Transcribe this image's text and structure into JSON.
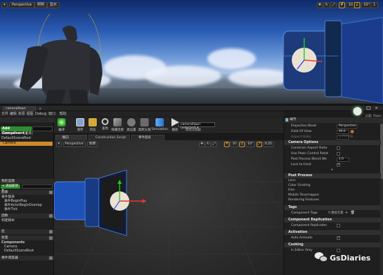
{
  "viewport": {
    "perspective_label": "Perspective",
    "lit_label": "照明",
    "show_label": "显示",
    "snap_value": "10",
    "angle_value": "10°",
    "scale_value": "0.25",
    "layer_value": "1"
  },
  "window": {
    "tab_title": "cameraPawn",
    "top_right_label": "父类: Pawn"
  },
  "menubar": {
    "items": [
      "文件",
      "编辑",
      "资源",
      "视图",
      "Debug",
      "窗口",
      "帮助"
    ]
  },
  "toolbar": {
    "buttons": [
      {
        "label": "编译",
        "icon": "compile-icon"
      },
      {
        "label": "保存",
        "icon": "save-icon"
      },
      {
        "label": "浏览",
        "icon": "browse-icon"
      },
      {
        "label": "查找",
        "icon": "find-icon"
      },
      {
        "label": "隐藏连接",
        "icon": "hide-connections-icon"
      },
      {
        "label": "类设置",
        "icon": "class-settings-icon"
      },
      {
        "label": "类默认值",
        "icon": "class-defaults-icon"
      },
      {
        "label": "Simulation",
        "icon": "simulation-icon"
      },
      {
        "label": "播放",
        "icon": "play-icon"
      }
    ],
    "debug_select_value": "cameraPawn (selected) ▾",
    "debug_filter_label": "调试过滤器"
  },
  "components": {
    "add_component_label": "Add Component ▾",
    "self_label": "cameraPawn (自身)",
    "tree": [
      {
        "label": "DefaultSceneRoot",
        "selected": false
      },
      {
        "label": "Camera",
        "selected": true
      }
    ]
  },
  "my_blueprint": {
    "header": "我的蓝图",
    "add_new_label": "+ 添加新项 ▾",
    "graphs_label": "图表",
    "event_graph_label": "事件图表",
    "events": [
      "事件BeginPlay",
      "事件ActorBeginOverlap",
      "事件Tick"
    ],
    "functions_label": "函数",
    "construction_label": "构建脚本",
    "macros_label": "宏",
    "variables_label": "变量",
    "components_group_label": "Components",
    "component_vars": [
      "Camera",
      "DefaultSceneRoot"
    ],
    "dispatchers_label": "事件调度器"
  },
  "tabs": [
    {
      "label": "视口",
      "active": true
    },
    {
      "label": "Construction Script",
      "active": false
    },
    {
      "label": "事件图表",
      "active": false
    }
  ],
  "bp_viewport": {
    "perspective_label": "Perspective",
    "lit_label": "照明",
    "snap_value": "10",
    "angle_value": "10°",
    "scale_value": "0.25"
  },
  "details": {
    "header": "细节",
    "projection_mode": {
      "key": "Projection Mode",
      "value": "Perspective"
    },
    "field_of_view": {
      "key": "Field Of View",
      "value": "90.0"
    },
    "aspect_ratio": {
      "key": "Aspect Ratio",
      "value": "1.777778"
    },
    "camera_options": {
      "title": "Camera Options",
      "rows": [
        {
          "key": "Constrain Aspect Ratio",
          "checked": false
        },
        {
          "key": "Use Pawn Control Rotat",
          "checked": false
        },
        {
          "key": "Post Process Blend We",
          "value": "1.0"
        },
        {
          "key": "Lock to Hmd",
          "checked": true
        }
      ]
    },
    "post_process": {
      "title": "Post Process",
      "items": [
        "Lens",
        "Color Grading",
        "Film",
        "Mobile Tonemapper",
        "Rendering Features"
      ]
    },
    "tags": {
      "title": "Tags",
      "key": "Component Tags",
      "value": "0 数组元素"
    },
    "component_replication": {
      "title": "Component Replication",
      "key": "Component Replicates",
      "checked": false
    },
    "activation": {
      "title": "Activation",
      "key": "Auto Activate",
      "checked": true
    },
    "cooking": {
      "title": "Cooking",
      "key": "Is Editor Only",
      "checked": false
    }
  },
  "watermark": {
    "text": "GsDiaries"
  }
}
